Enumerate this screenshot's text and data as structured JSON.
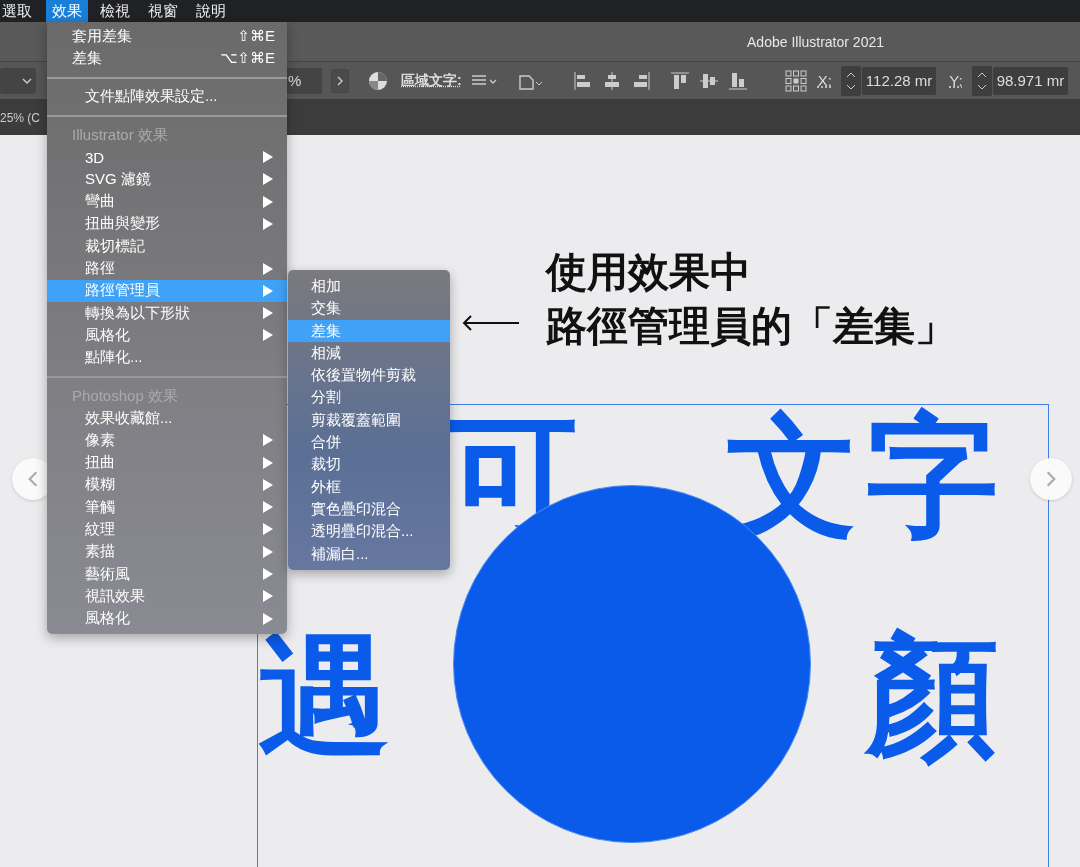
{
  "menu_bar": [
    {
      "label": "選取",
      "selected": false
    },
    {
      "label": "效果",
      "selected": true
    },
    {
      "label": "檢視",
      "selected": false
    },
    {
      "label": "視窗",
      "selected": false
    },
    {
      "label": "說明",
      "selected": false
    }
  ],
  "window": {
    "title": "Adobe Illustrator 2021"
  },
  "control_bar": {
    "percent": "%",
    "area_text_label": "區域文字:",
    "x_label": "X:",
    "x_value": "112.28 mr",
    "y_label": "Y:",
    "y_value": "98.971 mr"
  },
  "document_tab": {
    "label": "25% (C"
  },
  "effect_menu": [
    {
      "kind": "item",
      "label": "套用差集",
      "shortcut": "⇧⌘E",
      "submenu": false,
      "selected": false
    },
    {
      "kind": "item",
      "label": "差集",
      "shortcut": "⌥⇧⌘E",
      "submenu": false,
      "selected": false
    },
    {
      "kind": "separator"
    },
    {
      "kind": "item",
      "label": "文件點陣效果設定...",
      "submenu": false,
      "selected": false
    },
    {
      "kind": "separator"
    },
    {
      "kind": "header",
      "label": "Illustrator 效果"
    },
    {
      "kind": "item",
      "label": "3D",
      "submenu": true,
      "selected": false
    },
    {
      "kind": "item",
      "label": "SVG 濾鏡",
      "submenu": true,
      "selected": false
    },
    {
      "kind": "item",
      "label": "彎曲",
      "submenu": true,
      "selected": false
    },
    {
      "kind": "item",
      "label": "扭曲與變形",
      "submenu": true,
      "selected": false
    },
    {
      "kind": "item",
      "label": "裁切標記",
      "submenu": false,
      "selected": false
    },
    {
      "kind": "item",
      "label": "路徑",
      "submenu": true,
      "selected": false
    },
    {
      "kind": "item",
      "label": "路徑管理員",
      "submenu": true,
      "selected": true
    },
    {
      "kind": "item",
      "label": "轉換為以下形狀",
      "submenu": true,
      "selected": false
    },
    {
      "kind": "item",
      "label": "風格化",
      "submenu": true,
      "selected": false
    },
    {
      "kind": "item",
      "label": "點陣化...",
      "submenu": false,
      "selected": false
    },
    {
      "kind": "separator"
    },
    {
      "kind": "header",
      "label": "Photoshop 效果"
    },
    {
      "kind": "item",
      "label": "效果收藏館...",
      "submenu": false,
      "selected": false
    },
    {
      "kind": "item",
      "label": "像素",
      "submenu": true,
      "selected": false
    },
    {
      "kind": "item",
      "label": "扭曲",
      "submenu": true,
      "selected": false
    },
    {
      "kind": "item",
      "label": "模糊",
      "submenu": true,
      "selected": false
    },
    {
      "kind": "item",
      "label": "筆觸",
      "submenu": true,
      "selected": false
    },
    {
      "kind": "item",
      "label": "紋理",
      "submenu": true,
      "selected": false
    },
    {
      "kind": "item",
      "label": "素描",
      "submenu": true,
      "selected": false
    },
    {
      "kind": "item",
      "label": "藝術風",
      "submenu": true,
      "selected": false
    },
    {
      "kind": "item",
      "label": "視訊效果",
      "submenu": true,
      "selected": false
    },
    {
      "kind": "item",
      "label": "風格化",
      "submenu": true,
      "selected": false
    }
  ],
  "pathfinder_submenu": [
    {
      "label": "相加",
      "selected": false
    },
    {
      "label": "交集",
      "selected": false
    },
    {
      "label": "差集",
      "selected": true
    },
    {
      "label": "相減",
      "selected": false
    },
    {
      "label": "依後置物件剪裁",
      "selected": false
    },
    {
      "label": "分割",
      "selected": false
    },
    {
      "label": "剪裁覆蓋範圍",
      "selected": false
    },
    {
      "label": "合併",
      "selected": false
    },
    {
      "label": "裁切",
      "selected": false
    },
    {
      "label": "外框",
      "selected": false
    },
    {
      "label": "實色疊印混合",
      "selected": false
    },
    {
      "label": "透明疊印混合...",
      "selected": false
    },
    {
      "label": "補漏白...",
      "selected": false
    }
  ],
  "annotation": {
    "lines": [
      "使用效果中",
      "路徑管理員的「差集」"
    ]
  },
  "artwork": {
    "lines": [
      [
        "可",
        "文",
        "字"
      ],
      [
        "遇",
        "顏"
      ]
    ]
  }
}
